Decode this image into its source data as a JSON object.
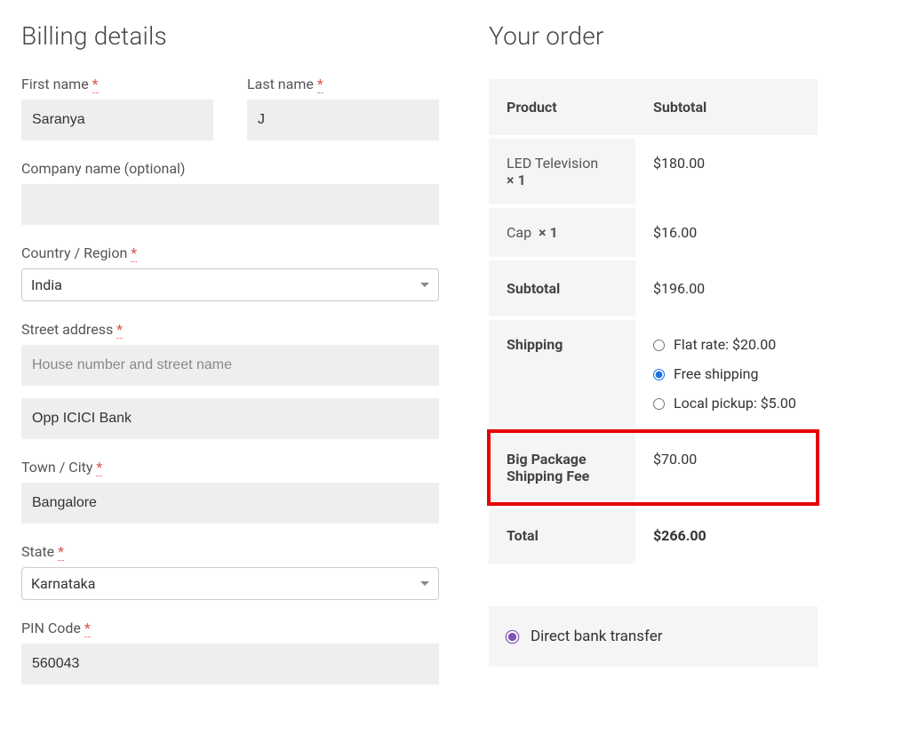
{
  "billing": {
    "title": "Billing details",
    "first_name": {
      "label": "First name",
      "value": "Saranya",
      "required_mark": "*"
    },
    "last_name": {
      "label": "Last name",
      "value": "J",
      "required_mark": "*"
    },
    "company": {
      "label": "Company name (optional)",
      "value": ""
    },
    "country": {
      "label": "Country / Region",
      "value": "India",
      "required_mark": "*"
    },
    "street": {
      "label": "Street address",
      "placeholder": "House number and street name",
      "required_mark": "*"
    },
    "street2": {
      "value": "Opp ICICI Bank"
    },
    "city": {
      "label": "Town / City",
      "value": "Bangalore",
      "required_mark": "*"
    },
    "state": {
      "label": "State",
      "value": "Karnataka",
      "required_mark": "*"
    },
    "pin": {
      "label": "PIN Code",
      "value": "560043",
      "required_mark": "*"
    }
  },
  "order": {
    "title": "Your order",
    "header_product": "Product",
    "header_subtotal": "Subtotal",
    "items": [
      {
        "name": "LED Television",
        "qty": "× 1",
        "subtotal": "$180.00"
      },
      {
        "name": "Cap",
        "qty": "× 1",
        "subtotal": "$16.00"
      }
    ],
    "subtotal_label": "Subtotal",
    "subtotal_value": "$196.00",
    "shipping_label": "Shipping",
    "shipping_options": [
      {
        "label": "Flat rate: $20.00",
        "checked": false
      },
      {
        "label": "Free shipping",
        "checked": true
      },
      {
        "label": "Local pickup: $5.00",
        "checked": false
      }
    ],
    "fee_label": "Big Package Shipping Fee",
    "fee_value": "$70.00",
    "total_label": "Total",
    "total_value": "$266.00"
  },
  "payment": {
    "option": "Direct bank transfer"
  }
}
